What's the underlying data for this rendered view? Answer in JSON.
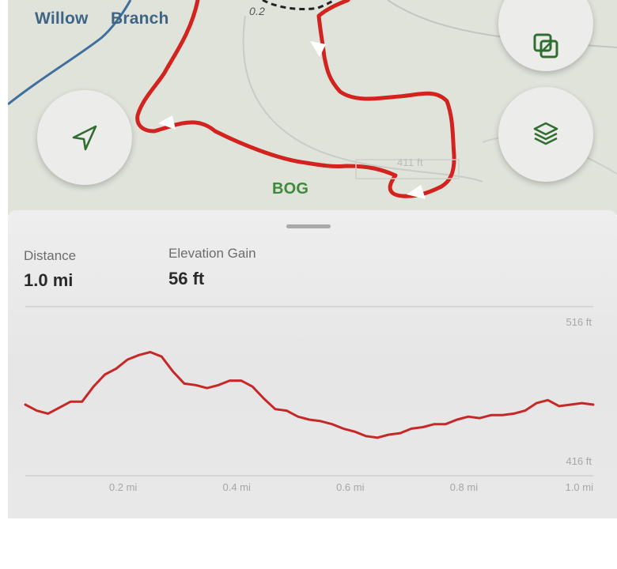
{
  "map": {
    "labels": {
      "willow": "Willow",
      "branch": "Branch",
      "bog": "BOG",
      "distance_marker": "0.2",
      "elevation_marker": "411 ft"
    },
    "route_color": "#d2231f",
    "creek_color": "#3f6f9c",
    "accent_green": "#3d8a3c"
  },
  "controls": {
    "locate_icon": "navigation-arrow-icon",
    "map_style_icon": "overlapping-squares-icon",
    "layers_icon": "stacked-layers-icon"
  },
  "stats": {
    "distance_label": "Distance",
    "distance_value": "1.0 mi",
    "elevation_gain_label": "Elevation Gain",
    "elevation_gain_value": "56 ft"
  },
  "chart_data": {
    "type": "line",
    "x_unit": "mi",
    "y_unit": "ft",
    "ylim": [
      416,
      516
    ],
    "xlim": [
      0,
      1.0
    ],
    "y_labels": [
      "516 ft",
      "416 ft"
    ],
    "x_ticks": [
      "0.2 mi",
      "0.4 mi",
      "0.6 mi",
      "0.8 mi",
      "1.0 mi"
    ],
    "grid": false,
    "color": "#c62828",
    "x": [
      0.0,
      0.02,
      0.04,
      0.06,
      0.08,
      0.1,
      0.12,
      0.14,
      0.16,
      0.18,
      0.2,
      0.22,
      0.24,
      0.26,
      0.28,
      0.3,
      0.32,
      0.34,
      0.36,
      0.38,
      0.4,
      0.42,
      0.44,
      0.46,
      0.48,
      0.5,
      0.52,
      0.54,
      0.56,
      0.58,
      0.6,
      0.62,
      0.64,
      0.66,
      0.68,
      0.7,
      0.72,
      0.74,
      0.76,
      0.78,
      0.8,
      0.82,
      0.84,
      0.86,
      0.88,
      0.9,
      0.92,
      0.94,
      0.96,
      0.98,
      1.0
    ],
    "y": [
      456,
      452,
      450,
      454,
      458,
      458,
      468,
      476,
      480,
      486,
      489,
      491,
      488,
      478,
      470,
      469,
      467,
      469,
      472,
      472,
      468,
      460,
      453,
      452,
      448,
      446,
      445,
      443,
      440,
      438,
      435,
      434,
      436,
      437,
      440,
      441,
      443,
      443,
      446,
      448,
      447,
      449,
      449,
      450,
      452,
      457,
      459,
      455,
      456,
      457,
      456
    ]
  }
}
